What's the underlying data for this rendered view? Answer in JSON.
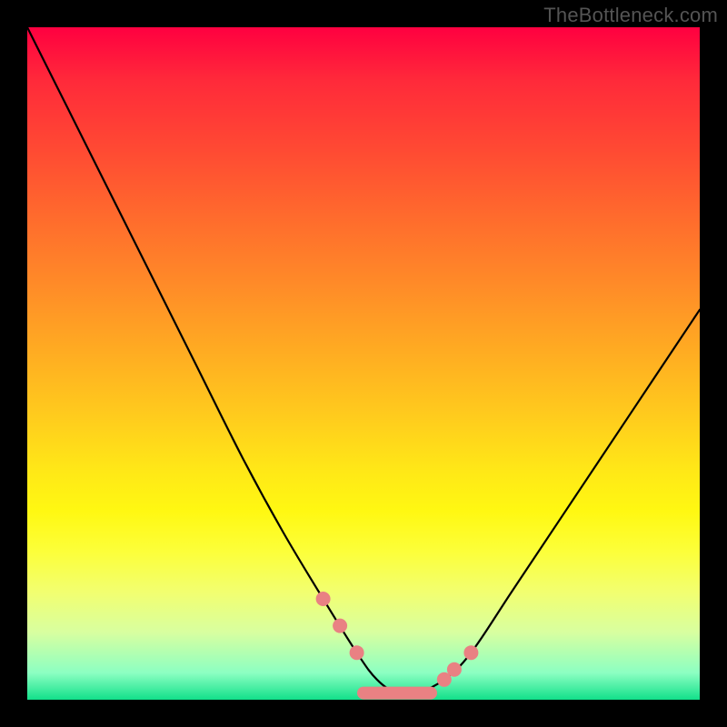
{
  "watermark": "TheBottleneck.com",
  "chart_data": {
    "type": "line",
    "title": "",
    "xlabel": "",
    "ylabel": "",
    "xlim": [
      0,
      100
    ],
    "ylim": [
      0,
      100
    ],
    "grid": false,
    "legend": false,
    "series": [
      {
        "name": "curve",
        "x": [
          0,
          6,
          12,
          18,
          25,
          32,
          38,
          44,
          49,
          52,
          55,
          58,
          62,
          66,
          72,
          80,
          90,
          100
        ],
        "values": [
          100,
          88,
          76,
          64,
          50,
          36,
          25,
          15,
          7,
          3,
          1,
          1,
          3,
          7,
          16,
          28,
          43,
          58
        ]
      }
    ],
    "markers": {
      "dots_left": [
        {
          "x": 44,
          "y": 15
        },
        {
          "x": 46.5,
          "y": 11
        },
        {
          "x": 49,
          "y": 7
        }
      ],
      "dots_right": [
        {
          "x": 62,
          "y": 3
        },
        {
          "x": 63.5,
          "y": 4.5
        },
        {
          "x": 66,
          "y": 7
        }
      ],
      "bottom_segment": {
        "x0": 50,
        "x1": 60,
        "y": 1
      }
    },
    "annotations": []
  }
}
